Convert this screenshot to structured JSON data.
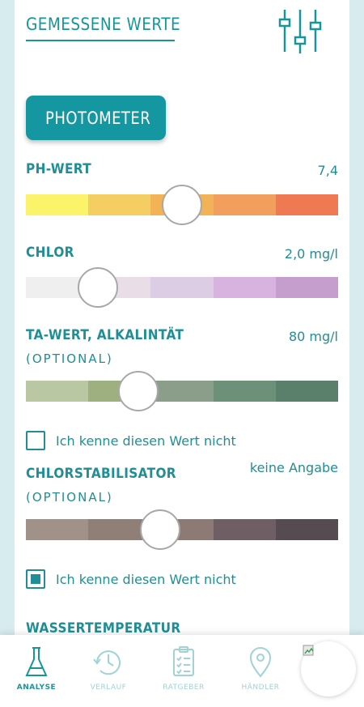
{
  "header": {
    "title": "GEMESSENE WERTE"
  },
  "photometer": {
    "label": "PHOTOMETER"
  },
  "measurements": {
    "ph": {
      "label": "PH-WERT",
      "value": "7,4",
      "colors": [
        "#fbf46a",
        "#f4cd63",
        "#f1b355",
        "#f29e5c",
        "#ee7952"
      ],
      "position": 0.5
    },
    "chlor": {
      "label": "CHLOR",
      "value": "2,0 mg/l",
      "colors": [
        "#efefef",
        "#e9dde7",
        "#dccde5",
        "#d8b3e0",
        "#c59ecd"
      ],
      "position": 0.23
    },
    "ta": {
      "label": "TA-WERT, ALKALINTÄT",
      "sub": "(OPTIONAL)",
      "value": "80 mg/l",
      "colors": [
        "#bac7a3",
        "#9eb07f",
        "#8a9e89",
        "#6c9078",
        "#5a7f6a"
      ],
      "position": 0.36,
      "unknown_label": "Ich kenne diesen Wert nicht",
      "unknown_checked": false
    },
    "stab": {
      "label": "CHLORSTABILISATOR",
      "sub": "(OPTIONAL)",
      "value": "keine Angabe",
      "colors": [
        "#a09189",
        "#8f7f77",
        "#8e7a75",
        "#6f5e64",
        "#574b52"
      ],
      "position": 0.43,
      "unknown_label": "Ich kenne diesen Wert nicht",
      "unknown_checked": true
    },
    "temp": {
      "label": "WASSERTEMPERATUR"
    }
  },
  "nav": {
    "items": [
      {
        "label": "ANALYSE",
        "icon": "flask-icon",
        "active": true
      },
      {
        "label": "VERLAUF",
        "icon": "history-icon",
        "active": false
      },
      {
        "label": "RATGEBER",
        "icon": "clipboard-icon",
        "active": false
      },
      {
        "label": "HÄNDLER",
        "icon": "location-pin-icon",
        "active": false
      }
    ],
    "active_color": "#16969b",
    "inactive_color": "#9fd3d6"
  }
}
